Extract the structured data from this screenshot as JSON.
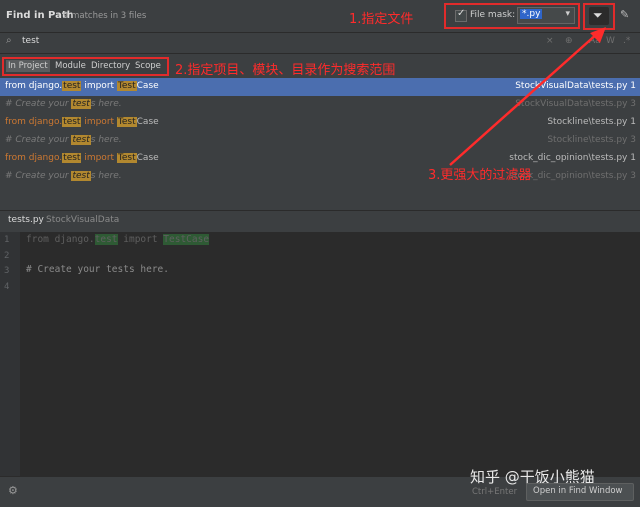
{
  "header": {
    "title": "Find in Path",
    "subtitle": "9 matches in 3 files",
    "file_mask_label": "File mask:",
    "file_mask_value": "*.py"
  },
  "search": {
    "query": "test",
    "right_icons": [
      "×",
      "⊕",
      "Aa",
      "W",
      ".*"
    ]
  },
  "scope": {
    "items": [
      "In Project",
      "Module",
      "Directory",
      "Scope"
    ],
    "active": "In Project"
  },
  "annotations": {
    "one": "1.指定文件",
    "two": "2.指定项目、模块、目录作为搜索范围",
    "three": "3.更强大的过滤器"
  },
  "results": [
    {
      "pre": "from django.",
      "hl1": "test",
      "mid": " import ",
      "hl2": "Test",
      "post": "Case",
      "loc": "StockVisualData\\tests.py",
      "n": "1",
      "type": "code"
    },
    {
      "pre": "# Create your ",
      "hl1": "test",
      "post": "s here.",
      "loc": "StockVisualData\\tests.py",
      "n": "3",
      "type": "comment"
    },
    {
      "pre": "from django.",
      "hl1": "test",
      "mid": " import ",
      "hl2": "Test",
      "post": "Case",
      "loc": "Stockline\\tests.py",
      "n": "1",
      "type": "code"
    },
    {
      "pre": "# Create your ",
      "hl1": "test",
      "post": "s here.",
      "loc": "Stockline\\tests.py",
      "n": "3",
      "type": "comment"
    },
    {
      "pre": "from django.",
      "hl1": "test",
      "mid": " import ",
      "hl2": "Test",
      "post": "Case",
      "loc": "stock_dic_opinion\\tests.py",
      "n": "1",
      "type": "code"
    },
    {
      "pre": "# Create your ",
      "hl1": "test",
      "post": "s here.",
      "loc": "stock_dic_opinion\\tests.py",
      "n": "3",
      "type": "comment"
    }
  ],
  "preview": {
    "file": "tests.py",
    "folder": "StockVisualData",
    "lines": [
      "1",
      "2",
      "3",
      "4"
    ],
    "code1_a": "from django.",
    "code1_b": "test",
    "code1_c": " import ",
    "code1_d": "TestCase",
    "code3": "# Create your tests here."
  },
  "footer": {
    "shortcut": "Ctrl+Enter",
    "open_button": "Open in Find Window",
    "watermark": "知乎 @干饭小熊猫"
  }
}
